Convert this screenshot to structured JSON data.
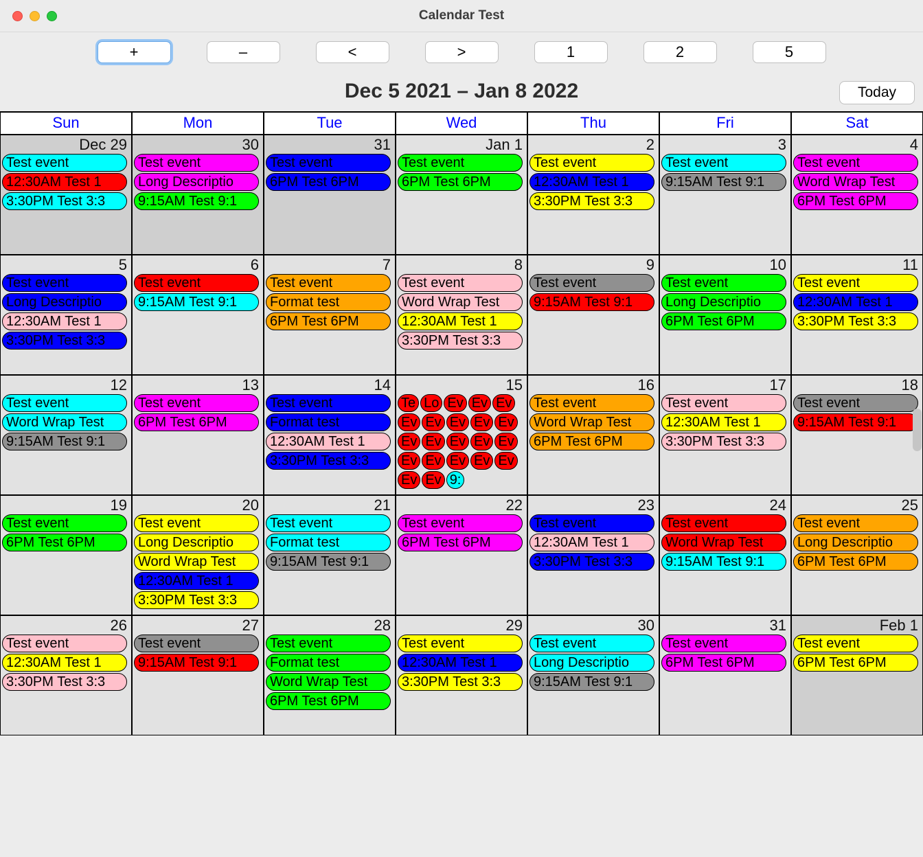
{
  "window": {
    "title": "Calendar Test"
  },
  "toolbar": {
    "plus": "+",
    "minus": "–",
    "prev": "<",
    "next": ">",
    "one": "1",
    "two": "2",
    "five": "5"
  },
  "range_title": "Dec 5 2021 – Jan 8 2022",
  "today_label": "Today",
  "day_headers": [
    "Sun",
    "Mon",
    "Tue",
    "Wed",
    "Thu",
    "Fri",
    "Sat"
  ],
  "colors": {
    "cyan": "c-cyan",
    "red": "c-red",
    "magenta": "c-magenta",
    "blue": "c-blue",
    "green": "c-green",
    "yellow": "c-yellow",
    "gray": "c-gray",
    "pink": "c-pink",
    "orange": "c-orange"
  },
  "cells": [
    {
      "label": "Dec 29",
      "out": true,
      "events": [
        {
          "t": "Test event",
          "c": "cyan"
        },
        {
          "t": "12:30AM Test 1",
          "c": "red"
        },
        {
          "t": "3:30PM Test 3:3",
          "c": "cyan"
        }
      ]
    },
    {
      "label": "30",
      "out": true,
      "events": [
        {
          "t": "Test event",
          "c": "magenta"
        },
        {
          "t": "Long Descriptio",
          "c": "magenta"
        },
        {
          "t": "9:15AM Test 9:1",
          "c": "green"
        }
      ]
    },
    {
      "label": "31",
      "out": true,
      "events": [
        {
          "t": "Test event",
          "c": "blue"
        },
        {
          "t": "6PM Test 6PM",
          "c": "blue"
        }
      ]
    },
    {
      "label": "Jan 1",
      "events": [
        {
          "t": "Test event",
          "c": "green"
        },
        {
          "t": "6PM Test 6PM",
          "c": "green"
        }
      ]
    },
    {
      "label": "2",
      "events": [
        {
          "t": "Test event",
          "c": "yellow"
        },
        {
          "t": "12:30AM Test 1",
          "c": "blue"
        },
        {
          "t": "3:30PM Test 3:3",
          "c": "yellow"
        }
      ]
    },
    {
      "label": "3",
      "events": [
        {
          "t": "Test event",
          "c": "cyan"
        },
        {
          "t": "9:15AM Test 9:1",
          "c": "gray"
        }
      ]
    },
    {
      "label": "4",
      "events": [
        {
          "t": "Test event",
          "c": "magenta"
        },
        {
          "t": "Word Wrap Test",
          "c": "magenta"
        },
        {
          "t": "6PM Test 6PM",
          "c": "magenta"
        }
      ]
    },
    {
      "label": "5",
      "events": [
        {
          "t": "Test event",
          "c": "blue"
        },
        {
          "t": "Long Descriptio",
          "c": "blue"
        },
        {
          "t": "12:30AM Test 1",
          "c": "pink"
        },
        {
          "t": "3:30PM Test 3:3",
          "c": "blue"
        }
      ]
    },
    {
      "label": "6",
      "events": [
        {
          "t": "Test event",
          "c": "red"
        },
        {
          "t": "9:15AM Test 9:1",
          "c": "cyan"
        }
      ]
    },
    {
      "label": "7",
      "events": [
        {
          "t": "Test event",
          "c": "orange"
        },
        {
          "t": "Format test",
          "c": "orange"
        },
        {
          "t": "6PM Test 6PM",
          "c": "orange"
        }
      ]
    },
    {
      "label": "8",
      "events": [
        {
          "t": "Test event",
          "c": "pink"
        },
        {
          "t": "Word Wrap Test",
          "c": "pink"
        },
        {
          "t": "12:30AM Test 1",
          "c": "yellow"
        },
        {
          "t": "3:30PM Test 3:3",
          "c": "pink"
        }
      ]
    },
    {
      "label": "9",
      "events": [
        {
          "t": "Test event",
          "c": "gray"
        },
        {
          "t": "9:15AM Test 9:1",
          "c": "red"
        }
      ]
    },
    {
      "label": "10",
      "events": [
        {
          "t": "Test event",
          "c": "green"
        },
        {
          "t": "Long Descriptio",
          "c": "green"
        },
        {
          "t": "6PM Test 6PM",
          "c": "green"
        }
      ]
    },
    {
      "label": "11",
      "events": [
        {
          "t": "Test event",
          "c": "yellow"
        },
        {
          "t": "12:30AM Test 1",
          "c": "blue"
        },
        {
          "t": "3:30PM Test 3:3",
          "c": "yellow"
        }
      ]
    },
    {
      "label": "12",
      "events": [
        {
          "t": "Test event",
          "c": "cyan"
        },
        {
          "t": "Word Wrap Test",
          "c": "cyan"
        },
        {
          "t": "9:15AM Test 9:1",
          "c": "gray"
        }
      ]
    },
    {
      "label": "13",
      "events": [
        {
          "t": "Test event",
          "c": "magenta"
        },
        {
          "t": "6PM Test 6PM",
          "c": "magenta"
        }
      ]
    },
    {
      "label": "14",
      "events": [
        {
          "t": "Test event",
          "c": "blue"
        },
        {
          "t": "Format test",
          "c": "blue"
        },
        {
          "t": "12:30AM Test 1",
          "c": "pink"
        },
        {
          "t": "3:30PM Test 3:3",
          "c": "blue"
        }
      ]
    },
    {
      "label": "15",
      "small": true,
      "events": [
        {
          "t": "Te",
          "c": "red"
        },
        {
          "t": "Lo",
          "c": "red"
        },
        {
          "t": "Ev",
          "c": "red"
        },
        {
          "t": "Ev",
          "c": "red"
        },
        {
          "t": "Ev",
          "c": "red"
        },
        {
          "t": "Ev",
          "c": "red"
        },
        {
          "t": "Ev",
          "c": "red"
        },
        {
          "t": "Ev",
          "c": "red"
        },
        {
          "t": "Ev",
          "c": "red"
        },
        {
          "t": "Ev",
          "c": "red"
        },
        {
          "t": "Ev",
          "c": "red"
        },
        {
          "t": "Ev",
          "c": "red"
        },
        {
          "t": "Ev",
          "c": "red"
        },
        {
          "t": "Ev",
          "c": "red"
        },
        {
          "t": "Ev",
          "c": "red"
        },
        {
          "t": "Ev",
          "c": "red"
        },
        {
          "t": "Ev",
          "c": "red"
        },
        {
          "t": "Ev",
          "c": "red"
        },
        {
          "t": "Ev",
          "c": "red"
        },
        {
          "t": "Ev",
          "c": "red"
        },
        {
          "t": "Ev",
          "c": "red"
        },
        {
          "t": "Ev",
          "c": "red"
        },
        {
          "t": "9:",
          "c": "cyan"
        }
      ]
    },
    {
      "label": "16",
      "events": [
        {
          "t": "Test event",
          "c": "orange"
        },
        {
          "t": "Word Wrap Test",
          "c": "orange"
        },
        {
          "t": "6PM Test 6PM",
          "c": "orange"
        }
      ]
    },
    {
      "label": "17",
      "events": [
        {
          "t": "Test event",
          "c": "pink"
        },
        {
          "t": "12:30AM Test 1",
          "c": "yellow"
        },
        {
          "t": "3:30PM Test 3:3",
          "c": "pink"
        }
      ]
    },
    {
      "label": "18",
      "events": [
        {
          "t": "Test event",
          "c": "gray"
        },
        {
          "t": "9:15AM Test 9:1",
          "c": "red"
        }
      ]
    },
    {
      "label": "19",
      "events": [
        {
          "t": "Test event",
          "c": "green"
        },
        {
          "t": "6PM Test 6PM",
          "c": "green"
        }
      ]
    },
    {
      "label": "20",
      "events": [
        {
          "t": "Test event",
          "c": "yellow"
        },
        {
          "t": "Long Descriptio",
          "c": "yellow"
        },
        {
          "t": "Word Wrap Test",
          "c": "yellow"
        },
        {
          "t": "12:30AM Test 1",
          "c": "blue"
        },
        {
          "t": "3:30PM Test 3:3",
          "c": "yellow"
        }
      ]
    },
    {
      "label": "21",
      "events": [
        {
          "t": "Test event",
          "c": "cyan"
        },
        {
          "t": "Format test",
          "c": "cyan"
        },
        {
          "t": "9:15AM Test 9:1",
          "c": "gray"
        }
      ]
    },
    {
      "label": "22",
      "events": [
        {
          "t": "Test event",
          "c": "magenta"
        },
        {
          "t": "6PM Test 6PM",
          "c": "magenta"
        }
      ]
    },
    {
      "label": "23",
      "events": [
        {
          "t": "Test event",
          "c": "blue"
        },
        {
          "t": "12:30AM Test 1",
          "c": "pink"
        },
        {
          "t": "3:30PM Test 3:3",
          "c": "blue"
        }
      ]
    },
    {
      "label": "24",
      "events": [
        {
          "t": "Test event",
          "c": "red"
        },
        {
          "t": "Word Wrap Test",
          "c": "red"
        },
        {
          "t": "9:15AM Test 9:1",
          "c": "cyan"
        }
      ]
    },
    {
      "label": "25",
      "events": [
        {
          "t": "Test event",
          "c": "orange"
        },
        {
          "t": "Long Descriptio",
          "c": "orange"
        },
        {
          "t": "6PM Test 6PM",
          "c": "orange"
        }
      ]
    },
    {
      "label": "26",
      "events": [
        {
          "t": "Test event",
          "c": "pink"
        },
        {
          "t": "12:30AM Test 1",
          "c": "yellow"
        },
        {
          "t": "3:30PM Test 3:3",
          "c": "pink"
        }
      ]
    },
    {
      "label": "27",
      "events": [
        {
          "t": "Test event",
          "c": "gray"
        },
        {
          "t": "9:15AM Test 9:1",
          "c": "red"
        }
      ]
    },
    {
      "label": "28",
      "events": [
        {
          "t": "Test event",
          "c": "green"
        },
        {
          "t": "Format test",
          "c": "green"
        },
        {
          "t": "Word Wrap Test",
          "c": "green"
        },
        {
          "t": "6PM Test 6PM",
          "c": "green"
        }
      ]
    },
    {
      "label": "29",
      "events": [
        {
          "t": "Test event",
          "c": "yellow"
        },
        {
          "t": "12:30AM Test 1",
          "c": "blue"
        },
        {
          "t": "3:30PM Test 3:3",
          "c": "yellow"
        }
      ]
    },
    {
      "label": "30",
      "events": [
        {
          "t": "Test event",
          "c": "cyan"
        },
        {
          "t": "Long Descriptio",
          "c": "cyan"
        },
        {
          "t": "9:15AM Test 9:1",
          "c": "gray"
        }
      ]
    },
    {
      "label": "31",
      "events": [
        {
          "t": "Test event",
          "c": "magenta"
        },
        {
          "t": "6PM Test 6PM",
          "c": "magenta"
        }
      ]
    },
    {
      "label": "Feb 1",
      "out": true,
      "events": [
        {
          "t": "Test event",
          "c": "yellow"
        },
        {
          "t": "6PM Test 6PM",
          "c": "yellow"
        }
      ]
    }
  ]
}
